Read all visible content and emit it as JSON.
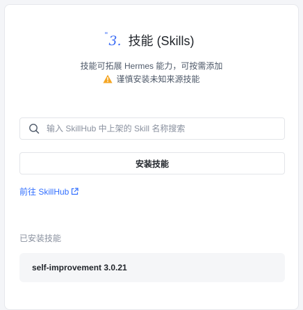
{
  "header": {
    "step_number": "3.",
    "step_quote": "\"",
    "title": "技能 (Skills)"
  },
  "description": "技能可拓展 Hermes 能力，可按需添加",
  "warning": {
    "icon": "warning-triangle-icon",
    "text": "谨慎安装未知来源技能",
    "color": "#f5a623"
  },
  "search": {
    "icon": "search-icon",
    "placeholder": "输入 SkillHub 中上架的 Skill 名称搜索",
    "value": ""
  },
  "install_button_label": "安装技能",
  "hub_link": {
    "label": "前往 SkillHub",
    "icon": "external-link-icon"
  },
  "installed": {
    "section_label": "已安装技能",
    "items": [
      {
        "label": "self-improvement 3.0.21"
      }
    ]
  },
  "colors": {
    "accent": "#3b6cf5",
    "link": "#3370ff",
    "warning": "#f5a623"
  }
}
